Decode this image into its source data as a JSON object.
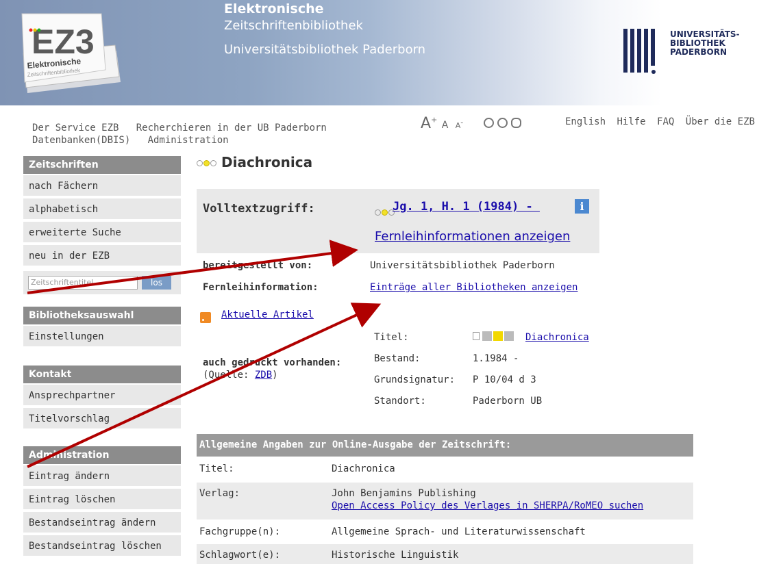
{
  "header": {
    "logo_text": "EZ3",
    "logo_sub1": "Elektronische",
    "logo_sub2": "Zeitschriftenbibliothek",
    "title_line1": "Elektronische",
    "title_line2": "Zeitschriftenbibliothek",
    "title_line3": "Universitätsbibliothek Paderborn",
    "ub_logo": [
      "UNIVERSITÄTS-",
      "BIBLIOTHEK",
      "PADERBORN"
    ]
  },
  "topnav": {
    "line1": "Der Service EZB   Recherchieren in der UB Paderborn",
    "line2": "Datenbanken(DBIS)   Administration",
    "font_a_plus": "A",
    "font_a": "A",
    "font_a_minus": "A",
    "lang_links": [
      "English",
      "Hilfe",
      "FAQ",
      "Über die EZB"
    ]
  },
  "sidebar": {
    "zeitschriften_head": "Zeitschriften",
    "zeitschriften_items": [
      "nach Fächern",
      "alphabetisch",
      "erweiterte Suche",
      "neu in der EZB"
    ],
    "search_placeholder": "Zeitschriftentitel",
    "search_button": "los",
    "bibliothek_head": "Bibliotheksauswahl",
    "bibliothek_items": [
      "Einstellungen"
    ],
    "kontakt_head": "Kontakt",
    "kontakt_items": [
      "Ansprechpartner",
      "Titelvorschlag"
    ],
    "admin_head": "Administration",
    "admin_items": [
      "Eintrag ändern",
      "Eintrag löschen",
      "Bestandseintrag ändern",
      "Bestandseintrag löschen"
    ]
  },
  "main": {
    "journal_title": "Diachronica",
    "volltext_label": "Volltextzugriff:",
    "volltext_link": "Jg. 1, H. 1 (1984) - ",
    "fernleihe_show": "Fernleihinformationen anzeigen",
    "bereitgestellt_label": "bereitgestellt von:",
    "bereitgestellt_value": "Universitätsbibliothek Paderborn",
    "fernleih_label": "Fernleihinformation:",
    "fernleih_value": "Einträge aller Bibliotheken anzeigen",
    "rss_link": "Aktuelle Artikel",
    "print_label": "auch gedruckt vorhanden:",
    "print_source_prefix": "(Quelle: ",
    "print_source_link": "ZDB",
    "print_source_suffix": ")",
    "print_rows": [
      {
        "k": "Titel:",
        "v": "Diachronica"
      },
      {
        "k": "Bestand:",
        "v": "1.1984 -"
      },
      {
        "k": "Grundsignatur:",
        "v": "P 10/04 d 3"
      },
      {
        "k": "Standort:",
        "v": "Paderborn UB"
      }
    ]
  },
  "general": {
    "head": "Allgemeine Angaben zur Online-Ausgabe der Zeitschrift:",
    "rows": [
      {
        "k": "Titel:",
        "v": "Diachronica"
      },
      {
        "k": "Verlag:",
        "v": "John Benjamins Publishing",
        "link": "Open Access Policy des Verlages in SHERPA/RoMEO suchen"
      },
      {
        "k": "Fachgruppe(n):",
        "v": "Allgemeine Sprach- und Literaturwissenschaft"
      },
      {
        "k": "Schlagwort(e):",
        "v": "Historische Linguistik"
      }
    ]
  },
  "colors": {
    "arrow": "#b00000",
    "sidebar_head": "#8c8c8c",
    "link": "#1a0dab",
    "dot_yellow": "#f2e12a"
  }
}
